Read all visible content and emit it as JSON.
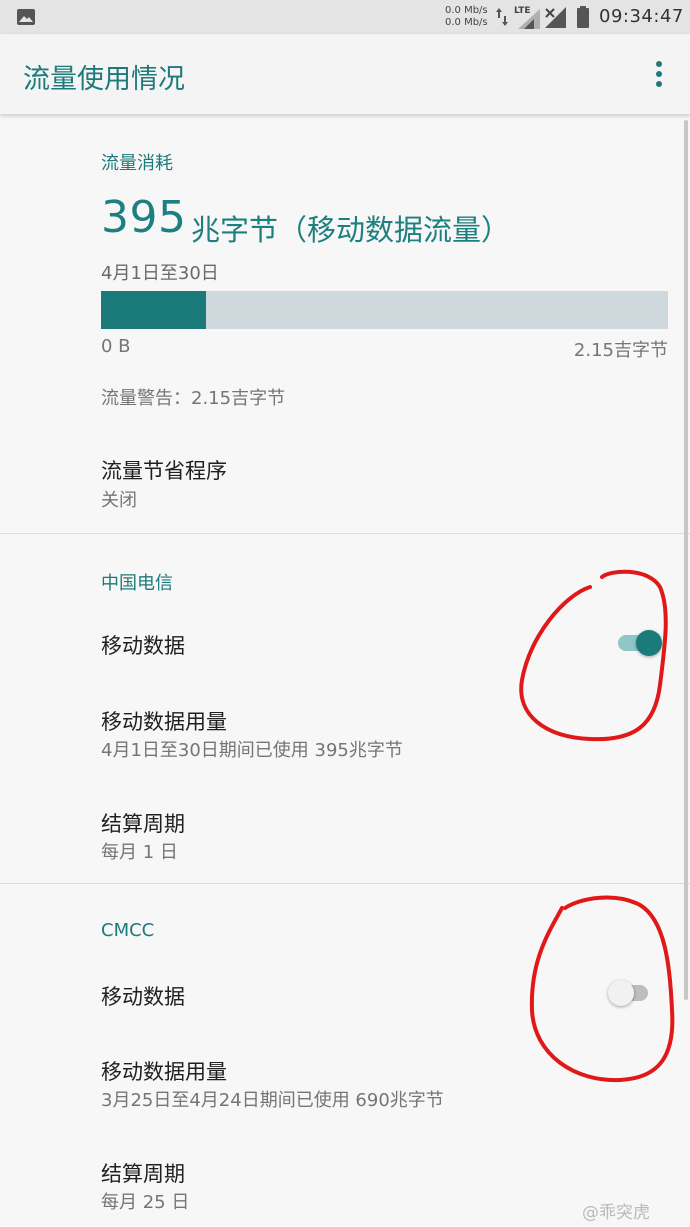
{
  "status_bar": {
    "speed_up": "0.0 Mb/s",
    "speed_down": "0.0 Mb/s",
    "network": "LTE",
    "time": "09:34:47"
  },
  "app_bar": {
    "title": "流量使用情况",
    "more_icon": "more-vert-icon"
  },
  "usage": {
    "section_label": "流量消耗",
    "amount": "395",
    "unit": "兆字节（移动数据流量）",
    "period": "4月1日至30日",
    "progress_fraction": 0.185,
    "scale_min": "0 B",
    "scale_max": "2.15吉字节",
    "warning": "流量警告：2.15吉字节"
  },
  "saver": {
    "title": "流量节省程序",
    "value": "关闭"
  },
  "carriers": [
    {
      "name": "中国电信",
      "mobile_data_label": "移动数据",
      "mobile_data_on": true,
      "usage_title": "移动数据用量",
      "usage_detail": "4月1日至30日期间已使用 395兆字节",
      "billing_title": "结算周期",
      "billing_value": "每月 1 日"
    },
    {
      "name": "CMCC",
      "mobile_data_label": "移动数据",
      "mobile_data_on": false,
      "usage_title": "移动数据用量",
      "usage_detail": "3月25日至4月24日期间已使用 690兆字节",
      "billing_title": "结算周期",
      "billing_value": "每月 25 日"
    }
  ],
  "watermark": "@乖突虎",
  "colors": {
    "accent": "#1d7f7f",
    "progress_track": "#cfd8dc",
    "annotation": "#e01818"
  }
}
